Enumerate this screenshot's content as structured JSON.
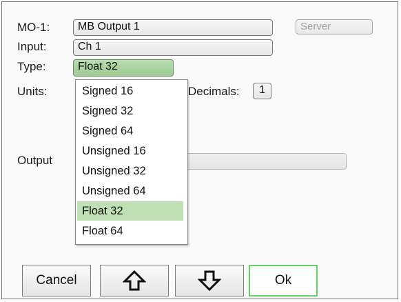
{
  "form": {
    "mo_label": "MO-1:",
    "mo_value": "MB Output 1",
    "server_label": "Server",
    "input_label": "Input:",
    "input_value": "Ch 1",
    "type_label": "Type:",
    "type_value": "Float 32",
    "units_label": "Units:",
    "decimals_label": "Decimals:",
    "decimals_value": "1",
    "output_label": "Output"
  },
  "type_dropdown": {
    "options": [
      "Signed 16",
      "Signed 32",
      "Signed 64",
      "Unsigned 16",
      "Unsigned 32",
      "Unsigned 64",
      "Float 32",
      "Float 64"
    ],
    "selected": "Float 32"
  },
  "buttons": {
    "cancel_label": "Cancel",
    "ok_label": "Ok",
    "up_icon": "arrow-up-icon",
    "down_icon": "arrow-down-icon"
  },
  "colors": {
    "selected_green": "#9dcb92",
    "ok_border": "#5ed45e"
  }
}
